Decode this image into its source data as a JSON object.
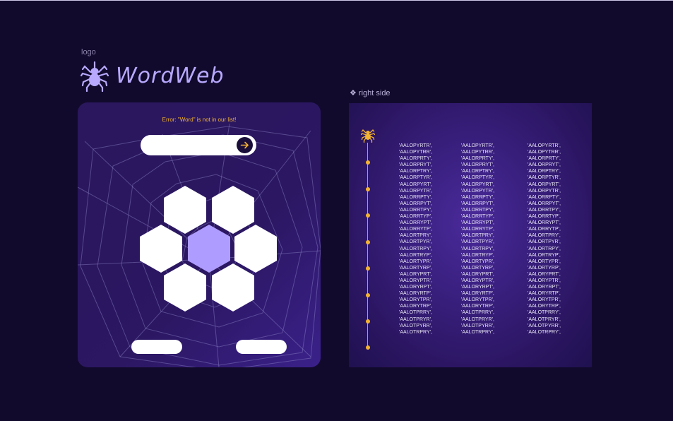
{
  "logo_caption": "logo",
  "app_name": "WordWeb",
  "game": {
    "error_message": "Error: \"Word\" is not in our list!",
    "word_input_value": "",
    "hex_tiles": [
      "",
      "",
      "",
      "",
      "",
      "",
      ""
    ],
    "left_button_label": "",
    "right_button_label": ""
  },
  "right_side_caption": "❖ right side",
  "words": [
    "'AALOPYRTR',",
    "'AALOPYTRR',",
    "'AALORPRTY',",
    "'AALORPRYT',",
    "'AALORPTRY',",
    "'AALORPTYR',",
    "'AALORPYRT',",
    "'AALORPYTR',",
    "'AALORRPTY',",
    "'AALORRPYT',",
    "'AALORRTPY',",
    "'AALORRTYP',",
    "'AALORRYPT',",
    "'AALORRYTP',",
    "'AALORTPRY',",
    "'AALORTPYR',",
    "'AALORTRPY',",
    "'AALORTRYP',",
    "'AALORTYPR',",
    "'AALORTYRP',",
    "'AALORYPRT',",
    "'AALORYPTR',",
    "'AALORYRPT',",
    "'AALORYRTP',",
    "'AALORYTPR',",
    "'AALORYTRP',",
    "'AALOTPRRY',",
    "'AALOTPRYR',",
    "'AALOTPYRR',",
    "'AALOTRPRY',"
  ],
  "colors": {
    "background": "#120a2d",
    "accent": "#f2b233",
    "hex_center": "#ae9cff",
    "logo": "#b8a9ff"
  },
  "icons": {
    "logo": "spider-icon",
    "timeline_top": "spider-icon",
    "submit": "arrow-right-icon"
  }
}
